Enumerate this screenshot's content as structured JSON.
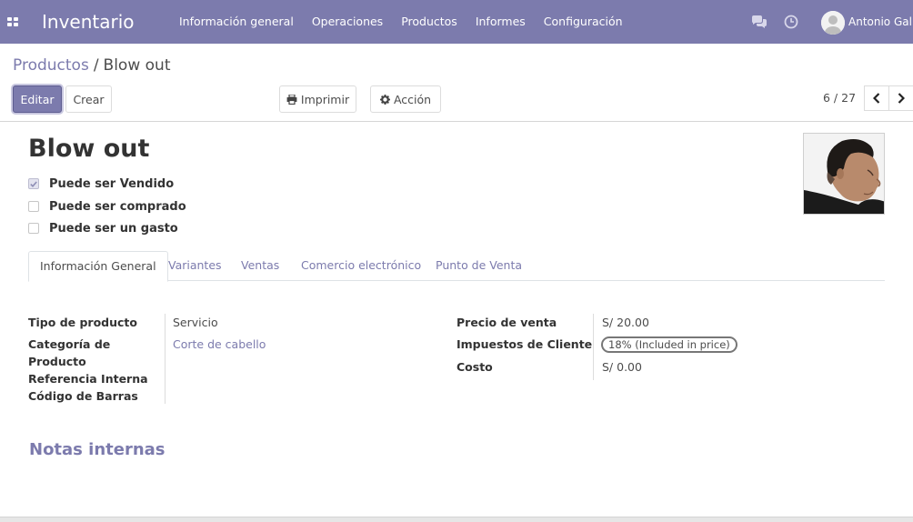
{
  "navbar": {
    "app_name": "Inventario",
    "background_color": "#7c7bad",
    "menu": [
      "Información general",
      "Operaciones",
      "Productos",
      "Informes",
      "Configuración"
    ],
    "icons": [
      "apps-grid-icon",
      "chat-icon",
      "clock-icon"
    ],
    "user_name": "Antonio Gall"
  },
  "breadcrumb": {
    "parent": "Productos",
    "separator": "/",
    "current": "Blow out"
  },
  "toolbar": {
    "edit_label": "Editar",
    "create_label": "Crear",
    "print_label": "Imprimir",
    "action_label": "Acción"
  },
  "pager": {
    "value": "6 / 27"
  },
  "product": {
    "name": "Blow out",
    "image_icon": "barber-customer-photo",
    "checkboxes": [
      {
        "label": "Puede ser Vendido",
        "checked": true
      },
      {
        "label": "Puede ser comprado",
        "checked": false
      },
      {
        "label": "Puede ser un gasto",
        "checked": false
      }
    ]
  },
  "tabs": [
    "Información General",
    "Variantes",
    "Ventas",
    "Comercio electrónico",
    "Punto de Venta"
  ],
  "active_tab": "Información General",
  "general_info": {
    "left": {
      "product_type_label": "Tipo de producto",
      "product_type_value": "Servicio",
      "category_label_line1": "Categoría de",
      "category_label_line2": "Producto",
      "category_value": "Corte de cabello",
      "internal_ref_label": "Referencia Interna",
      "barcode_label": "Código de Barras"
    },
    "right": {
      "sale_price_label": "Precio de venta",
      "sale_price_value": "S/ 20.00",
      "customer_taxes_label": "Impuestos de Cliente",
      "customer_taxes_value": "18% (Included in price)",
      "cost_label": "Costo",
      "cost_value": "S/ 0.00"
    }
  },
  "notes": {
    "title": "Notas internas"
  }
}
